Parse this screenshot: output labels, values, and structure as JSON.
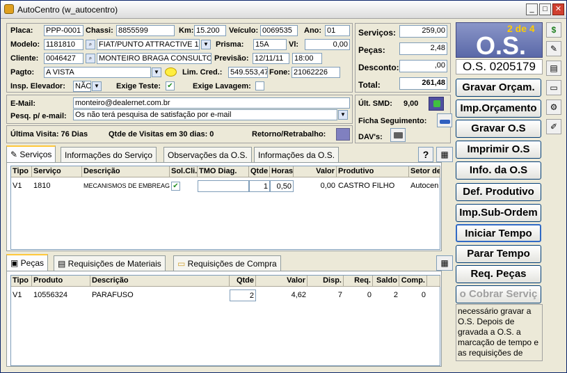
{
  "window": {
    "title": "AutoCentro (w_autocentro)"
  },
  "colors": {
    "accent": "#316ac5",
    "os_panel": "#6a78b0",
    "badge": "#ffcc00",
    "retorno": "#8080c0"
  },
  "header": {
    "placa_label": "Placa:",
    "placa": "PPP-0001",
    "chassi_label": "Chassi:",
    "chassi": "8855599",
    "km_label": "Km:",
    "km": "15.200",
    "veiculo_label": "Veículo:",
    "veiculo": "0069535",
    "ano_label": "Ano:",
    "ano": "01",
    "modelo_label": "Modelo:",
    "modelo_code": "1181810",
    "modelo_name": "FIAT/PUNTO ATTRACTIVE 1.4",
    "prisma_label": "Prisma:",
    "prisma": "15A",
    "vl_label": "Vl:",
    "vl": "0,00",
    "cliente_label": "Cliente:",
    "cliente_code": "0046427",
    "cliente_name": "MONTEIRO BRAGA CONSULTORIA",
    "previsao_label": "Previsão:",
    "previsao_date": "12/11/11",
    "previsao_time": "18:00",
    "pagto_label": "Pagto:",
    "pagto": "A VISTA",
    "lim_cred_label": "Lim. Cred.:",
    "lim_cred": "549.553,47",
    "fone_label": "Fone:",
    "fone": "21062226",
    "insp_label": "Insp. Elevador:",
    "insp": "NÃO",
    "exige_teste_label": "Exige Teste:",
    "exige_lavagem_label": "Exige Lavagem:",
    "email_label": "E-Mail:",
    "email": "monteiro@dealernet.com.br",
    "pesq_label": "Pesq. p/ e-mail:",
    "pesq": "Os não terá pesquisa de satisfação por e-mail",
    "ultima_visita": "Última Visita:  76 Dias",
    "qtde_visitas": "Qtde de Visitas em 30 dias:   0",
    "retorno": "Retorno/Retrabalho:"
  },
  "totals": {
    "servicos_label": "Serviços:",
    "servicos": "259,00",
    "pecas_label": "Peças:",
    "pecas": "2,48",
    "desconto_label": "Desconto:",
    "desconto": ",00",
    "total_label": "Total:",
    "total": "261,48",
    "ult_smd_label": "Últ. SMD:",
    "ult_smd": "9,00",
    "ficha_label": "Ficha  Seguimento:",
    "davs_label": "DAV's:"
  },
  "os_panel": {
    "badge": "2 de 4",
    "big": "O.S.",
    "number": "O.S. 0205179"
  },
  "buttons": {
    "gravar_orcam": "Gravar Orçam.",
    "imp_orcamento": "Imp.Orçamento",
    "gravar_os": "Gravar O.S",
    "imprimir_os": "Imprimir O.S",
    "info_os": "Info. da O.S",
    "def_produtivo": "Def. Produtivo",
    "imp_sub_ordem": "Imp.Sub-Ordem",
    "iniciar_tempo": "Iniciar Tempo",
    "parar_tempo": "Parar Tempo",
    "req_pecas": "Req. Peças",
    "cobrar": "o Cobrar Serviç"
  },
  "info_note": "necessário gravar a O.S. Depois de gravada a O.S. a marcação de tempo e as requisições de",
  "servicos_tabs": [
    "Serviços",
    "Informações do Serviço",
    "Observações da O.S.",
    "Informações da O.S."
  ],
  "servicos_table": {
    "headers": [
      "Tipo",
      "Serviço",
      "Descrição",
      "Sol.Cli.",
      "TMO Diag.",
      "Qtde",
      "Horas",
      "Valor",
      "Produtivo",
      "Setor de"
    ],
    "row": {
      "tipo": "V1",
      "servico": "1810",
      "descricao": "MECANISMOS DE EMBREAGEM",
      "qtde": "1",
      "horas": "0,50",
      "valor": "0,00",
      "produtivo": "CASTRO FILHO",
      "setor": "Autocen"
    }
  },
  "pecas_tabs": [
    "Peças",
    "Requisições de Materiais",
    "Requisições de Compra"
  ],
  "pecas_table": {
    "headers": [
      "Tipo",
      "Produto",
      "Descrição",
      "Qtde",
      "Valor",
      "Disp.",
      "Req.",
      "Saldo",
      "Comp."
    ],
    "row": {
      "tipo": "V1",
      "produto": "10556324",
      "descricao": "PARAFUSO",
      "qtde": "2",
      "valor": "4,62",
      "disp": "7",
      "req": "0",
      "saldo": "2",
      "comp": "0"
    }
  }
}
